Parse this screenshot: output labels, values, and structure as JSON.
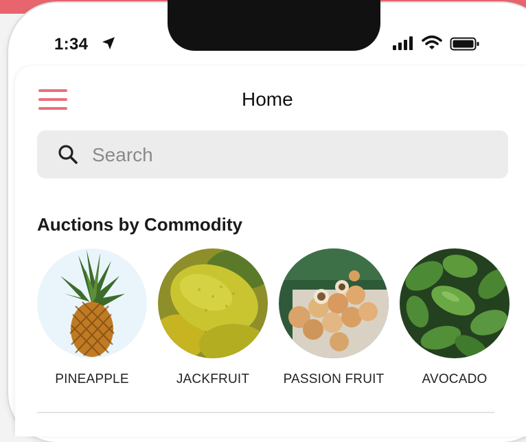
{
  "status_bar": {
    "time": "1:34"
  },
  "header": {
    "title": "Home"
  },
  "search": {
    "placeholder": "Search"
  },
  "section": {
    "title": "Auctions by Commodity"
  },
  "commodities": [
    {
      "label": "PINEAPPLE",
      "icon": "pineapple-image"
    },
    {
      "label": "JACKFRUIT",
      "icon": "jackfruit-image"
    },
    {
      "label": "PASSION FRUIT",
      "icon": "passion-fruit-image"
    },
    {
      "label": "AVOCADO",
      "icon": "avocado-image"
    }
  ],
  "colors": {
    "accent": "#e8707a",
    "banner": "#e8656e",
    "search_bg": "#ececec"
  }
}
